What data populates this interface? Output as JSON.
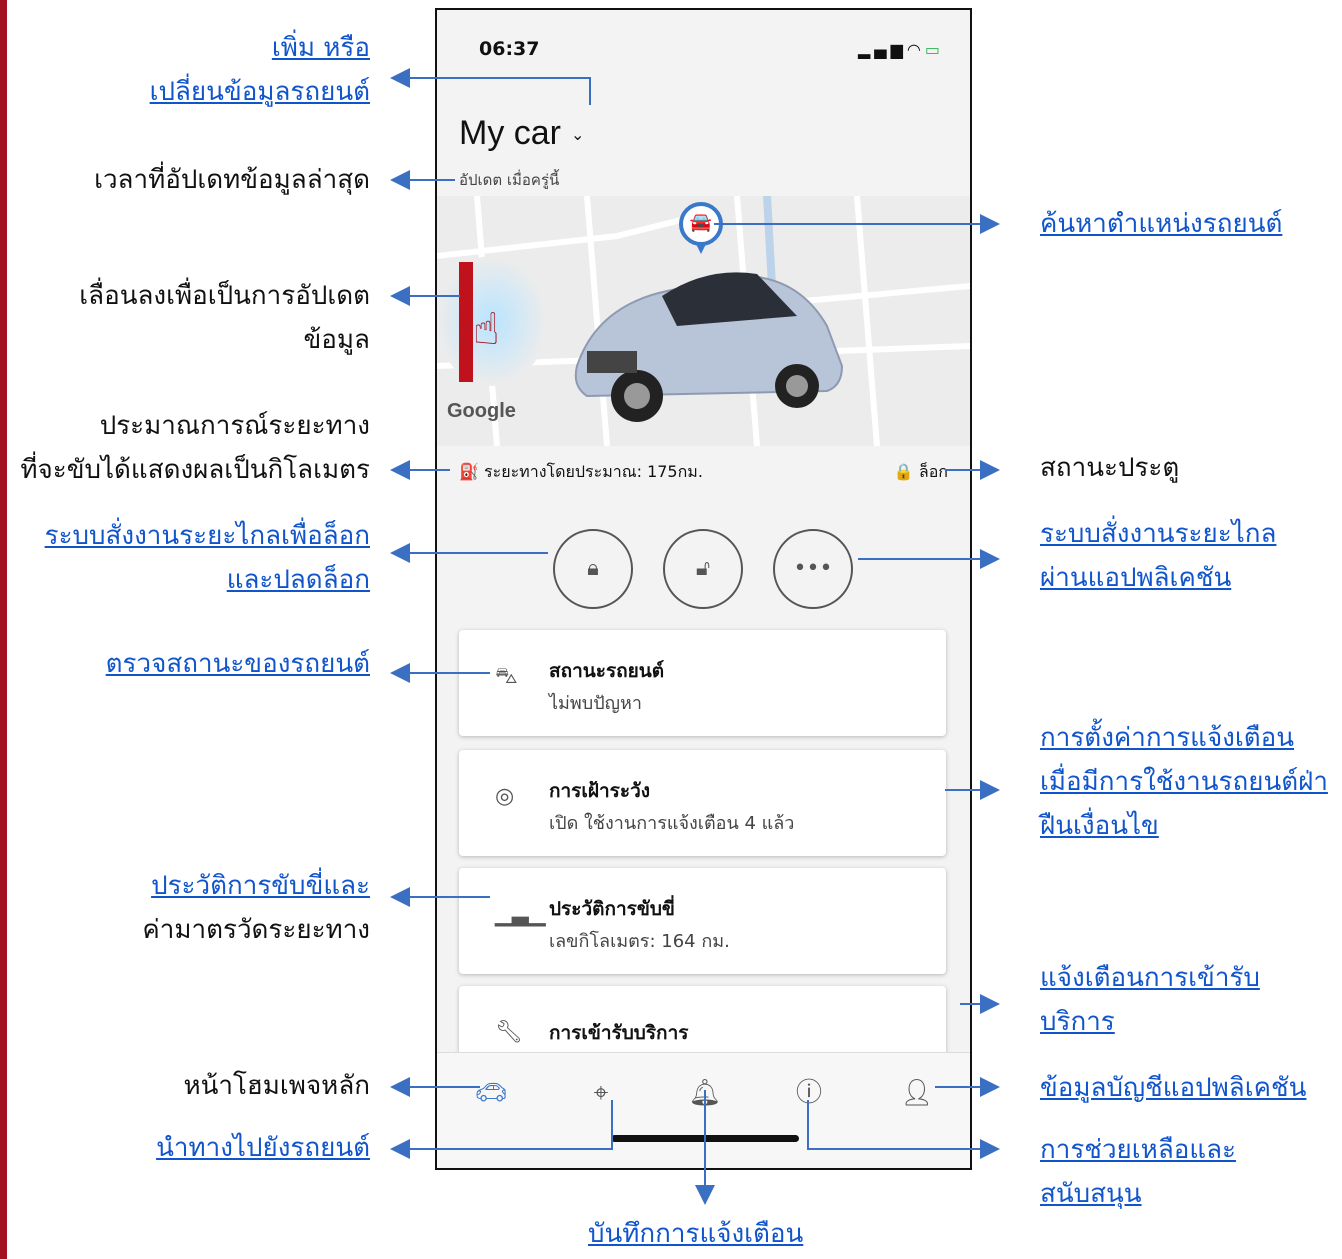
{
  "phone": {
    "status_time": "06:37",
    "status_icons": "signal-icon wifi-icon battery-charging-icon",
    "car_title": "My car",
    "updated_text": "อัปเดต เมื่อครู่นี้",
    "map_watermark": "Google",
    "range_text": "ระยะทางโดยประมาณ: 175กม.",
    "lock_status": "ล็อก",
    "remote_buttons": [
      "lock",
      "unlock",
      "more"
    ],
    "cards": [
      {
        "title": "สถานะรถยนต์",
        "subtitle": "ไม่พบปัญหา",
        "icon": "car-status-icon"
      },
      {
        "title": "การเฝ้าระวัง",
        "subtitle": "เปิด ใช้งานการแจ้งเตือน 4 แล้ว",
        "icon": "monitor-icon"
      },
      {
        "title": "ประวัติการขับขี่",
        "subtitle": "เลขกิโลเมตร: 164 กม.",
        "icon": "bar-chart-icon"
      },
      {
        "title": "การเข้ารับบริการ",
        "subtitle": "",
        "icon": "wrench-icon"
      }
    ],
    "tabs": [
      "car-icon",
      "map-pin-icon",
      "bell-icon",
      "help-icon",
      "person-icon"
    ],
    "accent_color": "#3a78c9"
  },
  "annotations": {
    "add_change_l1": "เพิ่ม หรือ",
    "add_change_l2": "เปลี่ยนข้อมูลรถยนต์",
    "last_update": "เวลาที่อัปเดทข้อมูลล่าสุด",
    "pull_down_l1": "เลื่อนลงเพื่อเป็นการอัปเดต",
    "pull_down_l2": "ข้อมูล",
    "range_l1": "ประมาณการณ์ระยะทาง",
    "range_l2": "ที่จะขับได้แสดงผลเป็นกิโลเมตร",
    "remote_lock_l1": "ระบบสั่งงานระยะไกลเพื่อล็อก",
    "remote_lock_l2": "และปลดล็อก",
    "check_status": "ตรวจสถานะของรถยนต์",
    "history_l1": "ประวัติการขับขี่และ",
    "history_l2": "ค่ามาตรวัดระยะทาง",
    "home": "หน้าโฮมเพจหลัก",
    "navigate": "นำทางไปยังรถยนต์",
    "notif_log": "บันทึกการแจ้งเตือน",
    "find_car": "ค้นหาตำแหน่งรถยนต์",
    "door_status": "สถานะประตู",
    "remote_app_l1": "ระบบสั่งงานระยะไกล",
    "remote_app_l2": "ผ่านแอปพลิเคชัน",
    "alert_l1": "การตั้งค่าการแจ้งเตือน",
    "alert_l2": "เมื่อมีการใช้งานรถยนต์ฝ่า",
    "alert_l3": "ฝืนเงื่อนไข",
    "service_l1": "แจ้งเตือนการเข้ารับ",
    "service_l2": "บริการ",
    "account": "ข้อมูลบัญชีแอปพลิเคชัน",
    "support_l1": "การช่วยเหลือและ",
    "support_l2": "สนับสนุน"
  }
}
